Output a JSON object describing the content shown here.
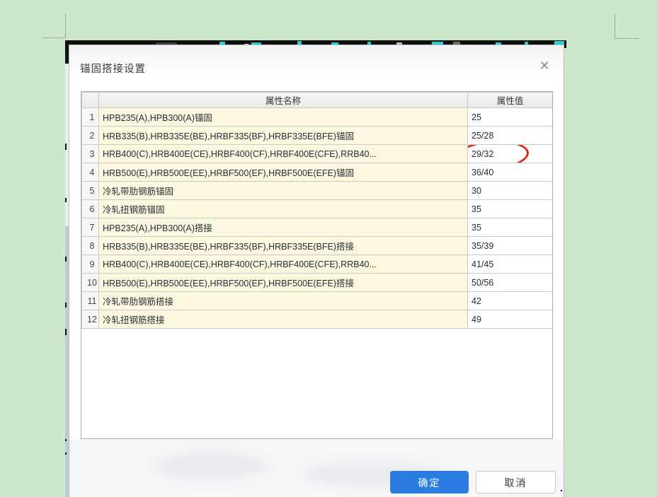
{
  "dialog": {
    "title": "锚固搭接设置"
  },
  "icons": {
    "close": "✕"
  },
  "table": {
    "headers": {
      "index": "",
      "name": "属性名称",
      "value": "属性值"
    },
    "rows": [
      {
        "index": "1",
        "name": "HPB235(A),HPB300(A)锚固",
        "value": "25",
        "circled": false
      },
      {
        "index": "2",
        "name": "HRB335(B),HRB335E(BE),HRBF335(BF),HRBF335E(BFE)锚固",
        "value": "25/28",
        "circled": false
      },
      {
        "index": "3",
        "name": "HRB400(C),HRB400E(CE),HRBF400(CF),HRBF400E(CFE),RRB40...",
        "value": "29/32",
        "circled": true
      },
      {
        "index": "4",
        "name": "HRB500(E),HRB500E(EE),HRBF500(EF),HRBF500E(EFE)锚固",
        "value": "36/40",
        "circled": false
      },
      {
        "index": "5",
        "name": "冷轧带肋钢筋锚固",
        "value": "30",
        "circled": false
      },
      {
        "index": "6",
        "name": "冷轧扭钢筋锚固",
        "value": "35",
        "circled": false
      },
      {
        "index": "7",
        "name": "HPB235(A),HPB300(A)搭接",
        "value": "35",
        "circled": false
      },
      {
        "index": "8",
        "name": "HRB335(B),HRB335E(BE),HRBF335(BF),HRBF335E(BFE)搭接",
        "value": "35/39",
        "circled": false
      },
      {
        "index": "9",
        "name": "HRB400(C),HRB400E(CE),HRBF400(CF),HRBF400E(CFE),RRB40...",
        "value": "41/45",
        "circled": false
      },
      {
        "index": "10",
        "name": "HRB500(E),HRB500E(EE),HRBF500(EF),HRBF500E(EFE)搭接",
        "value": "50/56",
        "circled": false
      },
      {
        "index": "11",
        "name": "冷轧带肋钢筋搭接",
        "value": "42",
        "circled": false
      },
      {
        "index": "12",
        "name": "冷轧扭钢筋搭接",
        "value": "49",
        "circled": false
      }
    ]
  },
  "buttons": {
    "ok": "确定",
    "cancel": "取消"
  },
  "annotation": {
    "type": "red-ellipse",
    "target_row": "3",
    "target_value": "29/32",
    "color": "#df2317"
  },
  "page": {
    "trailing_period": "."
  },
  "colors": {
    "page_background": "#cde7cb",
    "accent_blue": "#2b7de1",
    "row_name_background": "#fbf8df",
    "annotation_red": "#df2317"
  }
}
